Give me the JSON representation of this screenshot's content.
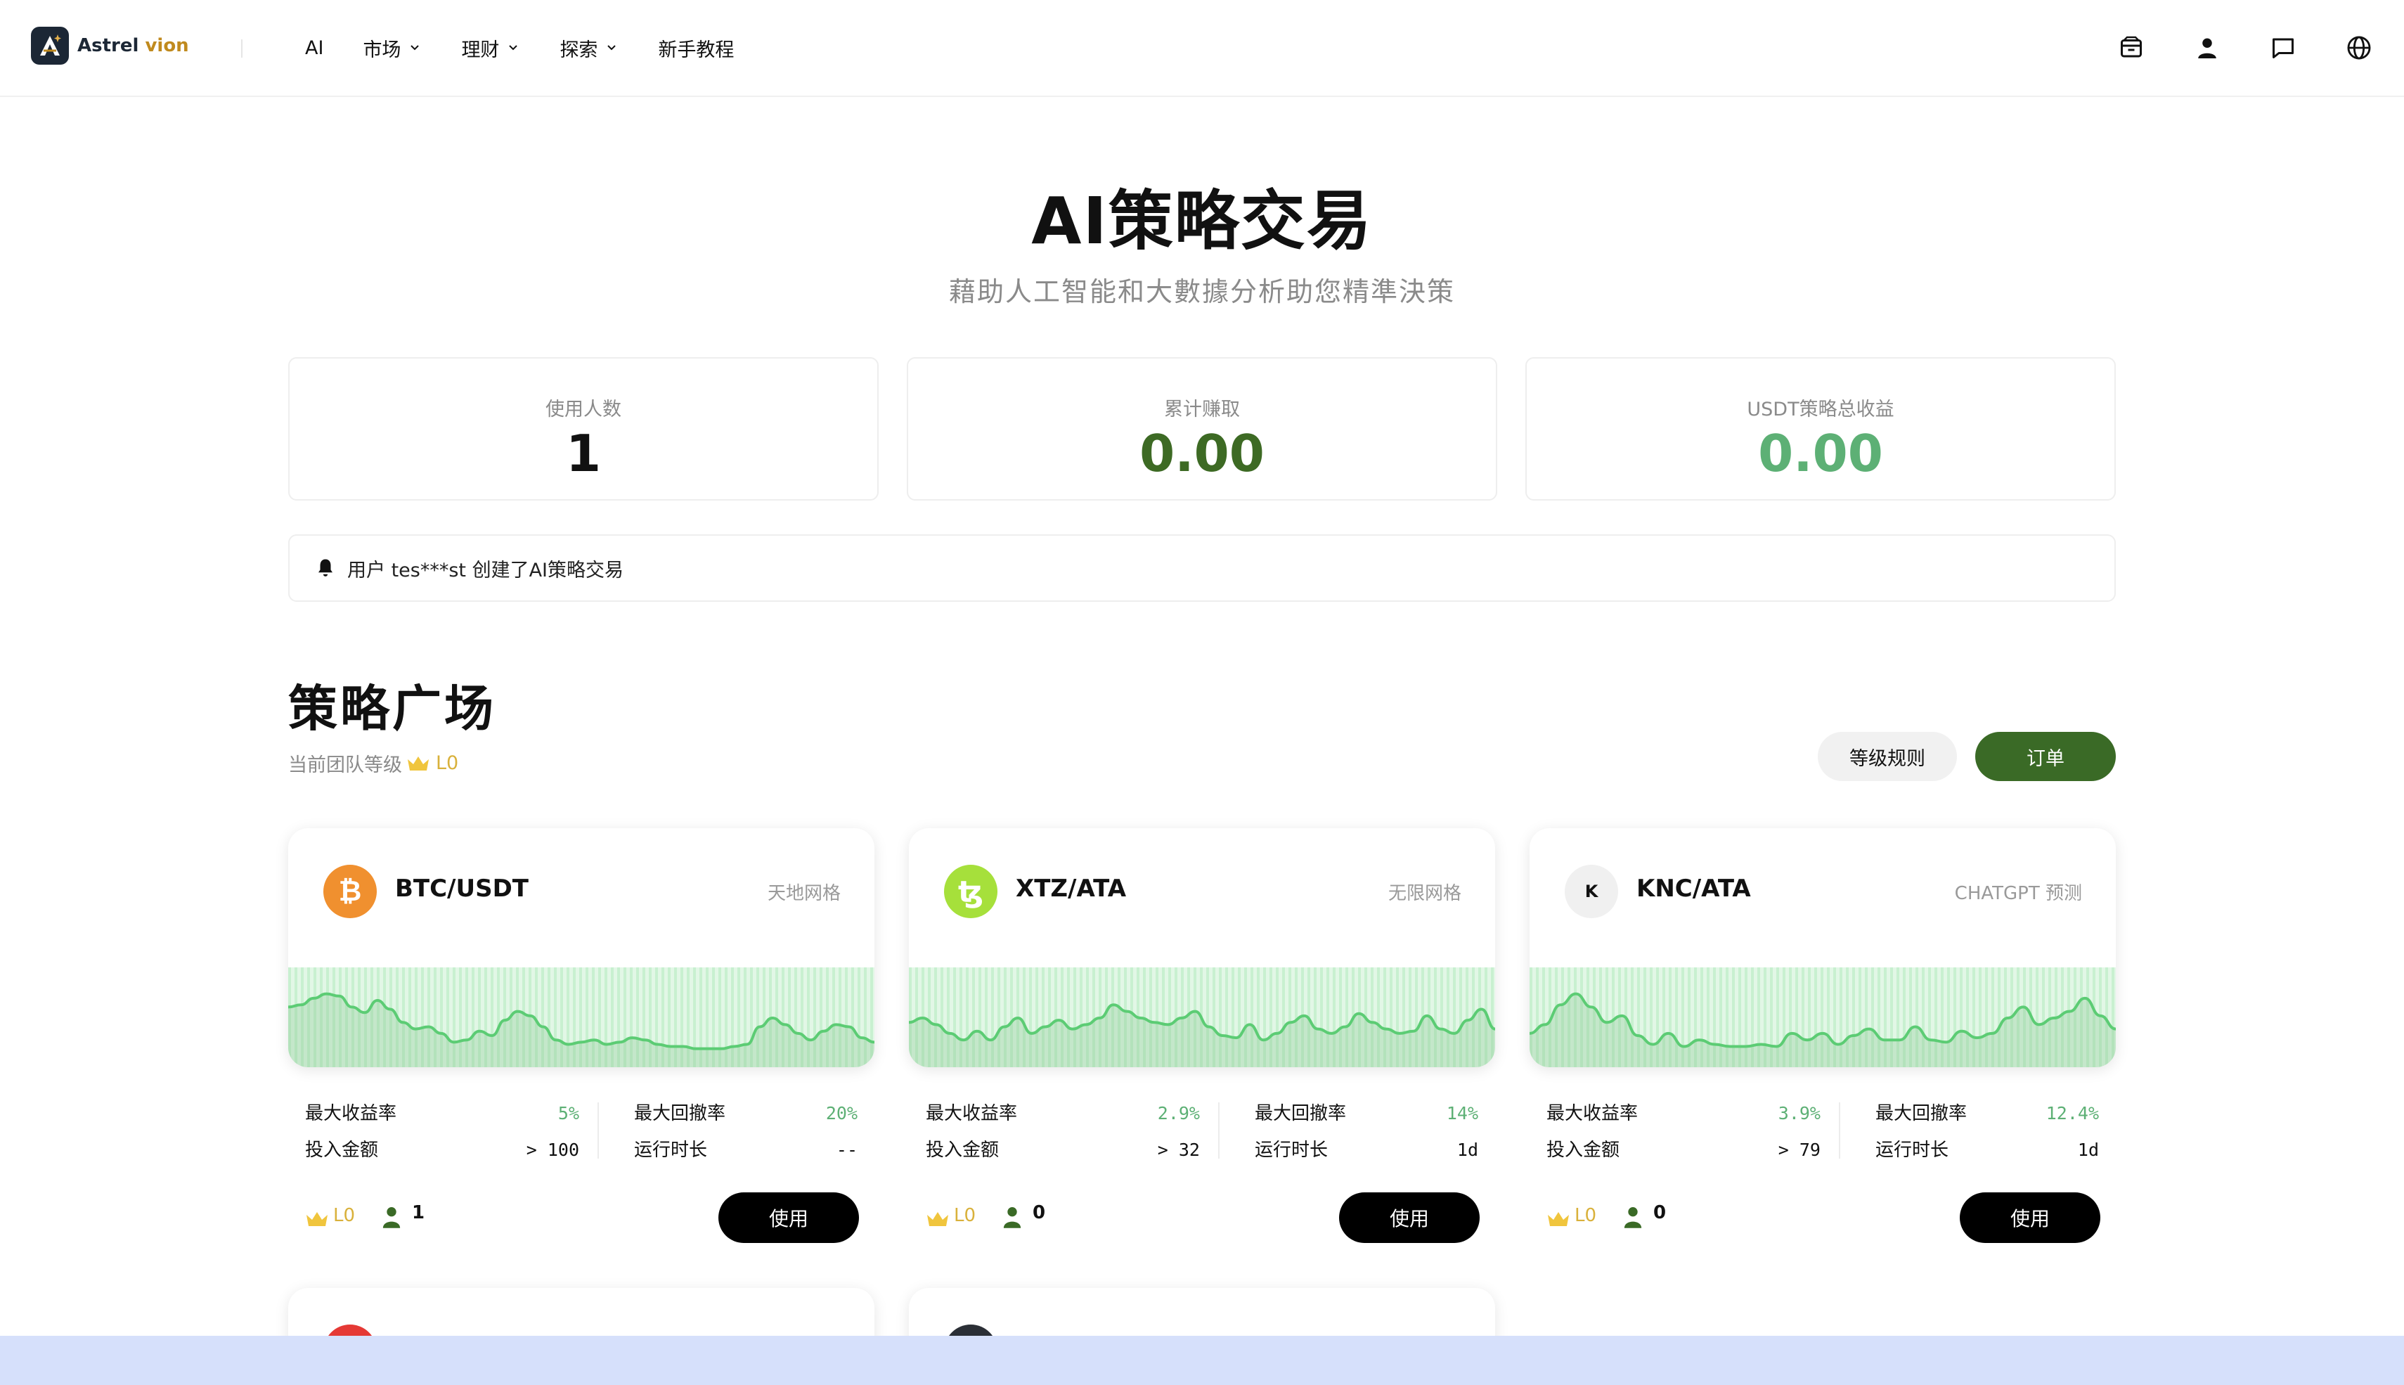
{
  "brand": {
    "name_main": "Astrel ",
    "name_accent": "vion",
    "accent_color": "#c08a1e"
  },
  "nav": {
    "items": [
      {
        "label": "AI",
        "has_dropdown": false
      },
      {
        "label": "市场",
        "has_dropdown": true
      },
      {
        "label": "理财",
        "has_dropdown": true
      },
      {
        "label": "探索",
        "has_dropdown": true
      },
      {
        "label": "新手教程",
        "has_dropdown": false
      }
    ],
    "icons": [
      "wallet-icon",
      "user-icon",
      "message-icon",
      "globe-icon"
    ]
  },
  "hero": {
    "title": "AI策略交易",
    "subtitle": "藉助人工智能和大數據分析助您精準決策"
  },
  "stats": [
    {
      "label": "使用人数",
      "value": "1"
    },
    {
      "label": "累计赚取",
      "value": "0.00"
    },
    {
      "label": "USDT策略总收益",
      "value": "0.00"
    }
  ],
  "notice": {
    "text": "用户 tes***st 创建了AI策略交易"
  },
  "plaza": {
    "title": "策略广场",
    "level_label": "当前团队等级",
    "level_value": "L0",
    "rules_button": "等级规则",
    "order_button": "订单"
  },
  "cards": [
    {
      "coin_icon": "bitcoin-icon",
      "coin_glyph": "₿",
      "coin_color": "#f0902f",
      "pair": "BTC/USDT",
      "strategy_type": "天地网格",
      "max_yield_label": "最大收益率",
      "max_yield": "5%",
      "max_drawdown_label": "最大回撤率",
      "max_drawdown": "20%",
      "invest_label": "投入金额",
      "invest": "> 100",
      "runtime_label": "运行时长",
      "runtime": "--",
      "level": "L0",
      "users": "1",
      "use_button": "使用"
    },
    {
      "coin_icon": "tezos-icon",
      "coin_glyph": "ꜩ",
      "coin_color": "#a6e03b",
      "pair": "XTZ/ATA",
      "strategy_type": "无限网格",
      "max_yield_label": "最大收益率",
      "max_yield": "2.9%",
      "max_drawdown_label": "最大回撤率",
      "max_drawdown": "14%",
      "invest_label": "投入金额",
      "invest": "> 32",
      "runtime_label": "运行时长",
      "runtime": "1d",
      "level": "L0",
      "users": "0",
      "use_button": "使用"
    },
    {
      "coin_icon": "kyber-icon",
      "coin_glyph": "K",
      "coin_color": "#f0f0f0",
      "pair": "KNC/ATA",
      "strategy_type": "CHATGPT 预测",
      "max_yield_label": "最大收益率",
      "max_yield": "3.9%",
      "max_drawdown_label": "最大回撤率",
      "max_drawdown": "12.4%",
      "invest_label": "投入金额",
      "invest": "> 79",
      "runtime_label": "运行时长",
      "runtime": "1d",
      "level": "L0",
      "users": "0",
      "use_button": "使用"
    }
  ],
  "sparklines": [
    [
      0.6,
      0.62,
      0.68,
      0.72,
      0.7,
      0.6,
      0.55,
      0.66,
      0.58,
      0.46,
      0.4,
      0.42,
      0.36,
      0.28,
      0.3,
      0.38,
      0.34,
      0.48,
      0.56,
      0.52,
      0.42,
      0.3,
      0.26,
      0.28,
      0.3,
      0.26,
      0.28,
      0.32,
      0.3,
      0.26,
      0.24,
      0.24,
      0.22,
      0.22,
      0.22,
      0.24,
      0.26,
      0.42,
      0.5,
      0.44,
      0.36,
      0.3,
      0.38,
      0.44,
      0.42,
      0.32,
      0.28
    ],
    [
      0.46,
      0.5,
      0.44,
      0.36,
      0.3,
      0.38,
      0.3,
      0.42,
      0.5,
      0.36,
      0.42,
      0.48,
      0.4,
      0.44,
      0.5,
      0.62,
      0.56,
      0.5,
      0.46,
      0.44,
      0.5,
      0.56,
      0.42,
      0.34,
      0.32,
      0.44,
      0.3,
      0.36,
      0.46,
      0.52,
      0.4,
      0.36,
      0.42,
      0.54,
      0.46,
      0.4,
      0.36,
      0.38,
      0.52,
      0.4,
      0.36,
      0.48,
      0.58,
      0.4
    ],
    [
      0.36,
      0.44,
      0.62,
      0.72,
      0.6,
      0.46,
      0.52,
      0.34,
      0.26,
      0.36,
      0.24,
      0.3,
      0.26,
      0.24,
      0.24,
      0.26,
      0.24,
      0.36,
      0.3,
      0.36,
      0.26,
      0.34,
      0.4,
      0.3,
      0.3,
      0.42,
      0.3,
      0.28,
      0.38,
      0.32,
      0.36,
      0.5,
      0.6,
      0.44,
      0.5,
      0.56,
      0.68,
      0.52,
      0.4
    ]
  ],
  "colors": {
    "primary_green": "#3a6a26",
    "profit_green": "#5db075",
    "chart_line": "#5ccc74",
    "chart_fill": "#c8f0d0",
    "gold": "#d9b13b"
  }
}
